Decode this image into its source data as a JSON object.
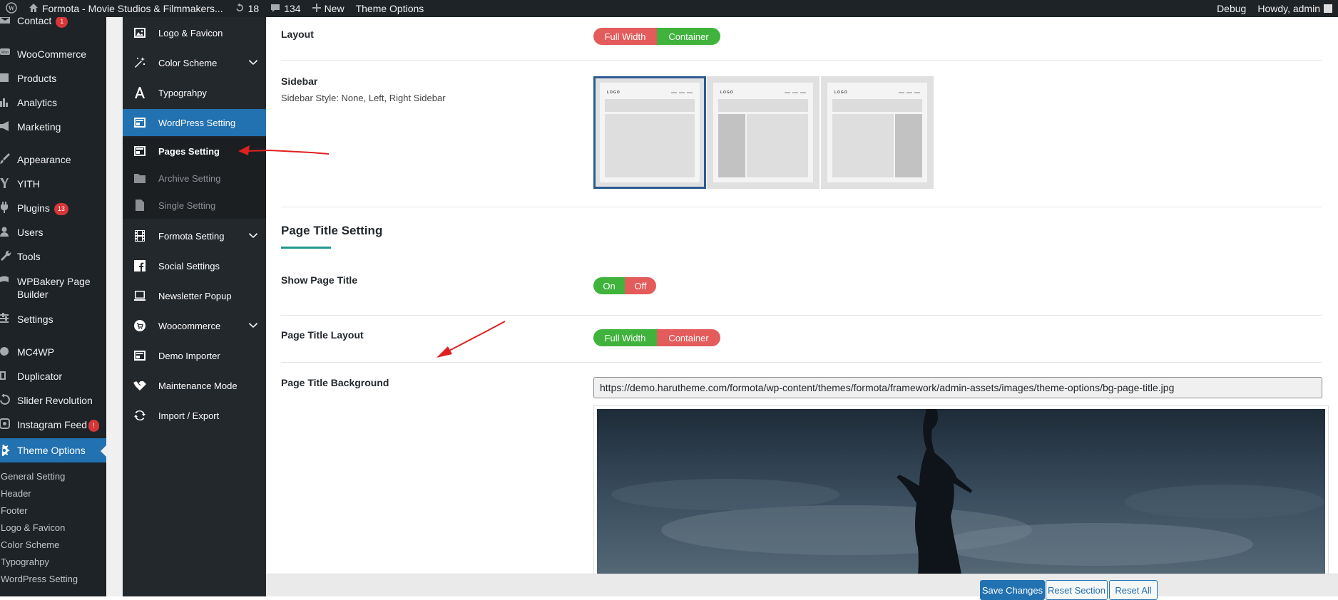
{
  "adminbar": {
    "site_title": "Formota - Movie Studios & Filmmakers...",
    "updates_count": "18",
    "comments_count": "134",
    "new_label": "New",
    "theme_options_label": "Theme Options",
    "debug_label": "Debug",
    "greeting": "Howdy, admin"
  },
  "adminmenu": {
    "items": [
      {
        "label": "Contact",
        "badge": "1",
        "icon": "mail-icon"
      },
      {
        "label": "WooCommerce",
        "icon": "woo-icon"
      },
      {
        "label": "Products",
        "icon": "archive-icon"
      },
      {
        "label": "Analytics",
        "icon": "chart-bar-icon"
      },
      {
        "label": "Marketing",
        "icon": "megaphone-icon"
      },
      {
        "label": "Appearance",
        "icon": "paintbrush-icon"
      },
      {
        "label": "YITH",
        "icon": "yith-icon"
      },
      {
        "label": "Plugins",
        "badge": "13",
        "icon": "plug-icon"
      },
      {
        "label": "Users",
        "icon": "user-icon"
      },
      {
        "label": "Tools",
        "icon": "wrench-icon"
      },
      {
        "label": "WPBakery Page Builder",
        "icon": "wpbakery-icon"
      },
      {
        "label": "Settings",
        "icon": "sliders-icon"
      },
      {
        "label": "MC4WP",
        "icon": "mc4wp-icon"
      },
      {
        "label": "Duplicator",
        "icon": "duplicator-icon"
      },
      {
        "label": "Slider Revolution",
        "icon": "refresh-icon"
      },
      {
        "label": "Instagram Feed",
        "badge": "!",
        "icon": "instagram-icon"
      },
      {
        "label": "Theme Options",
        "icon": "gear-icon",
        "current": true
      }
    ],
    "submenu": [
      "General Setting",
      "Header",
      "Footer",
      "Logo & Favicon",
      "Color Scheme",
      "Typograhpy",
      "WordPress Setting"
    ]
  },
  "optnav": {
    "items": [
      {
        "label": "Logo & Favicon",
        "icon": "image-icon"
      },
      {
        "label": "Color Scheme",
        "icon": "magic-wand-icon",
        "expandable": true
      },
      {
        "label": "Typograhpy",
        "icon": "font-icon"
      },
      {
        "label": "WordPress Setting",
        "icon": "layout-icon",
        "active": true
      },
      {
        "label": "Pages Setting",
        "icon": "layout-icon",
        "sub": true,
        "current": true
      },
      {
        "label": "Archive Setting",
        "icon": "folder-icon",
        "sub": true
      },
      {
        "label": "Single Setting",
        "icon": "file-icon",
        "sub": true
      },
      {
        "label": "Formota Setting",
        "icon": "film-icon",
        "expandable": true
      },
      {
        "label": "Social Settings",
        "icon": "facebook-icon"
      },
      {
        "label": "Newsletter Popup",
        "icon": "laptop-icon"
      },
      {
        "label": "Woocommerce",
        "icon": "cart-icon",
        "expandable": true
      },
      {
        "label": "Demo Importer",
        "icon": "layout-icon"
      },
      {
        "label": "Maintenance Mode",
        "icon": "handshake-icon"
      },
      {
        "label": "Import / Export",
        "icon": "refresh-icon"
      }
    ]
  },
  "main": {
    "layout": {
      "label": "Layout",
      "options": [
        "Full Width",
        "Container"
      ],
      "selected": "Container"
    },
    "sidebar": {
      "label": "Sidebar",
      "description": "Sidebar Style: None, Left, Right Sidebar",
      "options": [
        "none",
        "left",
        "right"
      ],
      "selected": "none",
      "preview_logo": "LOGO"
    },
    "page_title_section": "Page Title Setting",
    "show_page_title": {
      "label": "Show Page Title",
      "options": [
        "On",
        "Off"
      ],
      "selected": "On"
    },
    "page_title_layout": {
      "label": "Page Title Layout",
      "options": [
        "Full Width",
        "Container"
      ],
      "selected": "Full Width"
    },
    "page_title_background": {
      "label": "Page Title Background",
      "url": "https://demo.harutheme.com/formota/wp-content/themes/formota/framework/admin-assets/images/theme-options/bg-page-title.jpg"
    },
    "footer_buttons": {
      "save": "Save Changes",
      "reset_section": "Reset Section",
      "reset_all": "Reset All"
    }
  },
  "colors": {
    "accent": "#2271b1",
    "on_green": "#3fb33b",
    "off_red": "#e35b5b",
    "annotation_arrow": "#e02020",
    "section_underline": "#1f9a8c"
  }
}
